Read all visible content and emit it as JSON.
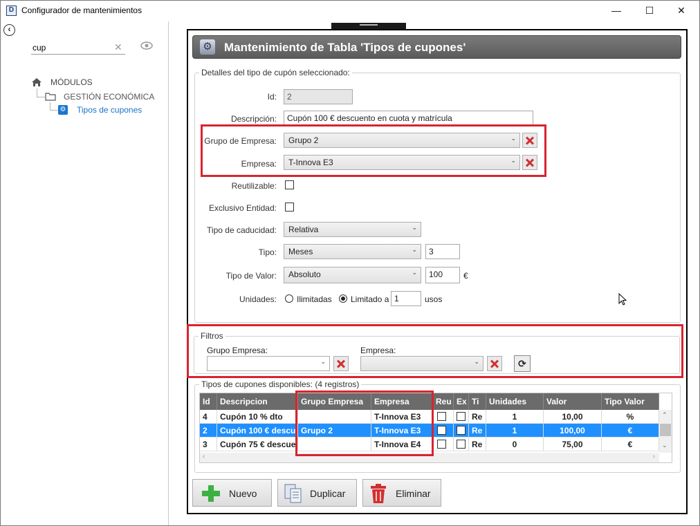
{
  "window": {
    "title": "Configurador de mantenimientos",
    "icon_letter": "D",
    "minimize": "—",
    "maximize": "☐",
    "close": "✕"
  },
  "sidebar": {
    "search_value": "cup",
    "tree": {
      "root": "MÓDULOS",
      "folder": "GESTIÓN ECONÓMICA",
      "item": "Tipos de cupones"
    }
  },
  "header": {
    "title": "Mantenimiento de Tabla 'Tipos de cupones'"
  },
  "details": {
    "legend": "Detalles del tipo de cupón seleccionado:",
    "id_label": "Id:",
    "id_value": "2",
    "descripcion_label": "Descripción:",
    "descripcion_value": "Cupón 100 € descuento en cuota y matrícula",
    "grupo_label": "Grupo de Empresa:",
    "grupo_value": "Grupo 2",
    "empresa_label": "Empresa:",
    "empresa_value": "T-Innova E3",
    "reutilizable_label": "Reutilizable:",
    "exclusivo_label": "Exclusivo Entidad:",
    "caducidad_label": "Tipo de caducidad:",
    "caducidad_value": "Relativa",
    "tipo_label": "Tipo:",
    "tipo_value": "Meses",
    "tipo_num": "3",
    "valor_label": "Tipo de Valor:",
    "valor_value": "Absoluto",
    "valor_num": "100",
    "valor_unit": "€",
    "unidades_label": "Unidades:",
    "ilimitadas_label": "Ilimitadas",
    "limitado_label": "Limitado a",
    "limitado_num": "1",
    "usos_label": "usos"
  },
  "filters": {
    "legend": "Filtros",
    "grupo_label": "Grupo Empresa:",
    "empresa_label": "Empresa:"
  },
  "table": {
    "legend": "Tipos de cupones disponibles:",
    "count": "(4 registros)",
    "headers": [
      "Id",
      "Descripcion",
      "Grupo Empresa",
      "Empresa",
      "Reu",
      "Ex",
      "Ti",
      "Unidades",
      "Valor",
      "Tipo Valor"
    ],
    "rows": [
      {
        "id": "4",
        "desc": "Cupón 10 % dto",
        "grupo": "",
        "empresa": "T-Innova E3",
        "ti": "Re",
        "unidades": "1",
        "valor": "10,00",
        "tipo": "%"
      },
      {
        "id": "2",
        "desc": "Cupón 100 € descue",
        "grupo": "Grupo 2",
        "empresa": "T-Innova E3",
        "ti": "Re",
        "unidades": "1",
        "valor": "100,00",
        "tipo": "€"
      },
      {
        "id": "3",
        "desc": "Cupón 75 € descue",
        "grupo": "",
        "empresa": "T-Innova E4",
        "ti": "Re",
        "unidades": "0",
        "valor": "75,00",
        "tipo": "€"
      }
    ]
  },
  "buttons": {
    "nuevo": "Nuevo",
    "duplicar": "Duplicar",
    "eliminar": "Eliminar"
  },
  "colors": {
    "highlight_red": "#d9232e",
    "selection_blue": "#1e90ff",
    "header_gray": "#6b6b6b"
  }
}
